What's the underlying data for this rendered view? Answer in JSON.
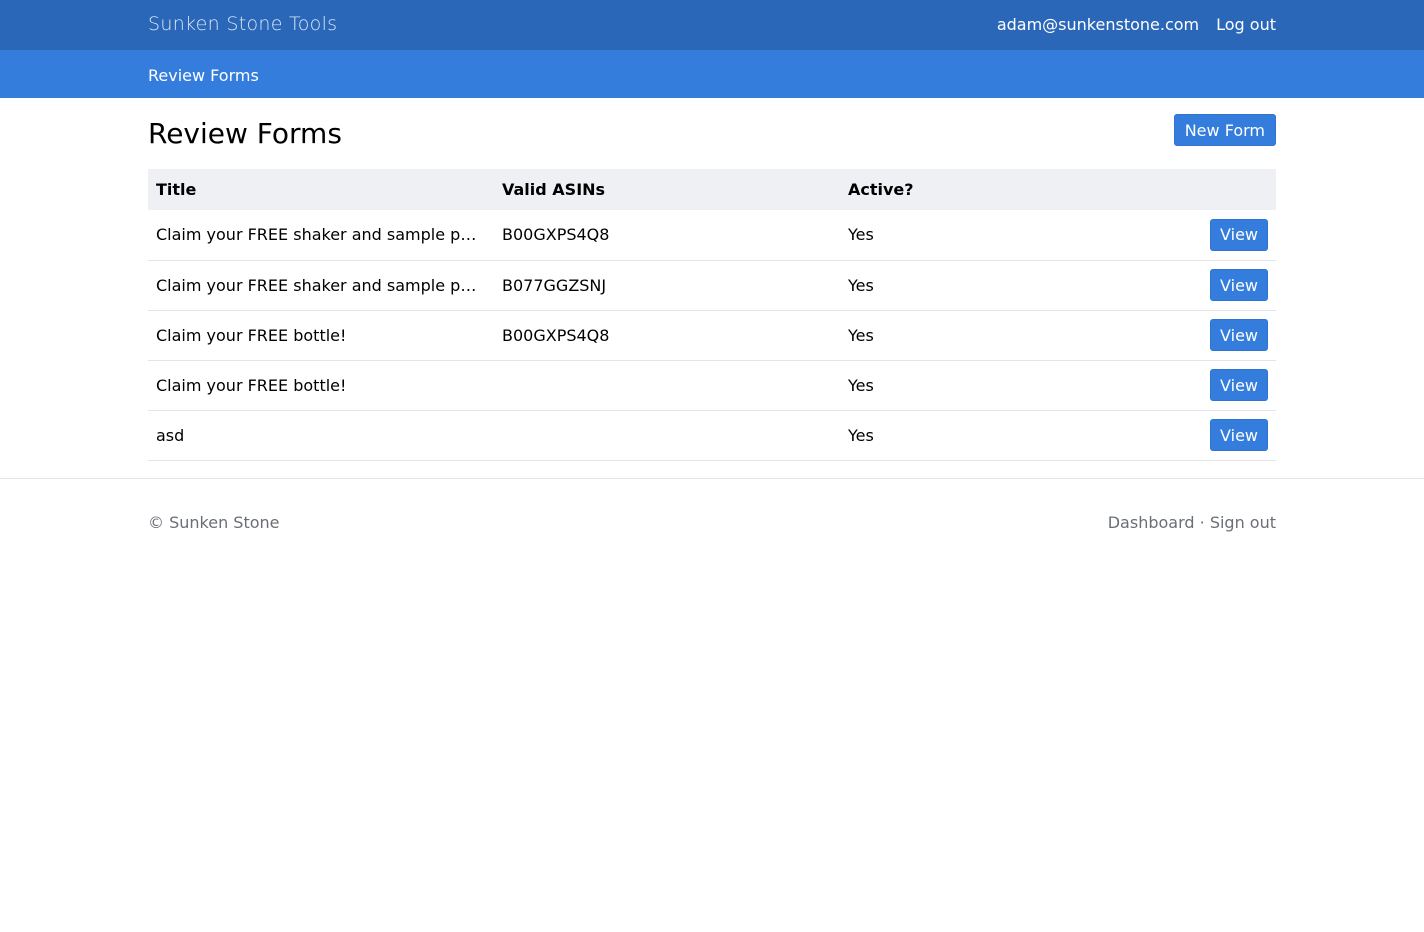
{
  "header": {
    "brand": "Sunken Stone Tools",
    "user_email": "adam@sunkenstone.com",
    "logout_label": "Log out"
  },
  "subnav": {
    "active": "Review Forms"
  },
  "page": {
    "title": "Review Forms",
    "new_button": "New Form"
  },
  "table": {
    "columns": [
      "Title",
      "Valid ASINs",
      "Active?"
    ],
    "rows": [
      {
        "title": "Claim your FREE shaker and sample pack!",
        "asins": "B00GXPS4Q8",
        "active": "Yes",
        "action": "View"
      },
      {
        "title": "Claim your FREE shaker and sample pack!",
        "asins": "B077GGZSNJ",
        "active": "Yes",
        "action": "View"
      },
      {
        "title": "Claim your FREE bottle!",
        "asins": "B00GXPS4Q8",
        "active": "Yes",
        "action": "View"
      },
      {
        "title": "Claim your FREE bottle!",
        "asins": "",
        "active": "Yes",
        "action": "View"
      },
      {
        "title": "asd",
        "asins": "",
        "active": "Yes",
        "action": "View"
      }
    ]
  },
  "footer": {
    "copyright": "© Sunken Stone",
    "links": [
      "Dashboard",
      "Sign out"
    ],
    "separator": " · "
  },
  "colors": {
    "topbar": "#2a67b9",
    "subbar": "#347ddd",
    "button": "#347ddd"
  }
}
